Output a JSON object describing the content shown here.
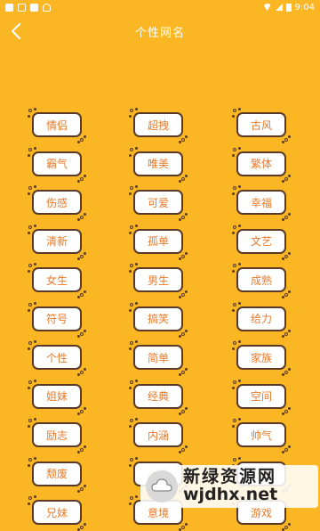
{
  "status_bar": {
    "time": "9:04",
    "icons": [
      "app-square-icon",
      "app-square-icon",
      "close-box-icon",
      "android-icon",
      "wifi-icon",
      "signal-icon",
      "battery-icon"
    ]
  },
  "header": {
    "title": "个性网名",
    "back_icon": "chevron-left-icon"
  },
  "categories": [
    [
      "情侣",
      "超拽",
      "古风"
    ],
    [
      "霸气",
      "唯美",
      "繁体"
    ],
    [
      "伤感",
      "可爱",
      "幸福"
    ],
    [
      "清新",
      "孤单",
      "文艺"
    ],
    [
      "女生",
      "男生",
      "成熟"
    ],
    [
      "符号",
      "搞笑",
      "给力"
    ],
    [
      "个性",
      "简单",
      "家族"
    ],
    [
      "姐妹",
      "经典",
      "空间"
    ],
    [
      "励志",
      "内涵",
      "帅气"
    ],
    [
      "颓废",
      "小孩",
      "兄弟"
    ],
    [
      "兄妹",
      "意境",
      "游戏"
    ]
  ],
  "watermark": {
    "cn": "新绿资源网",
    "en": "wjdhx.net"
  },
  "colors": {
    "background": "#FBB723",
    "tag_text": "#E97A2A",
    "tag_border": "#5A3A26"
  }
}
